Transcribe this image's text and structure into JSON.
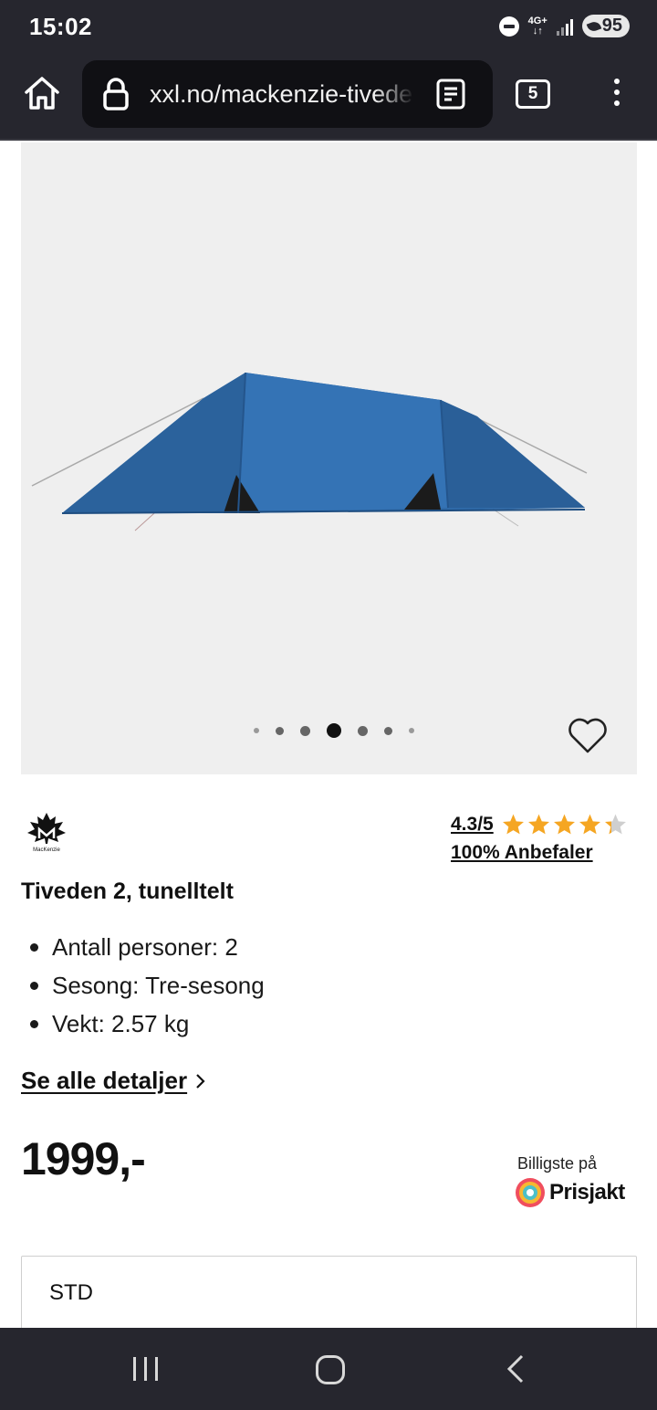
{
  "status_bar": {
    "time": "15:02",
    "network": "4G+",
    "battery": "95",
    "icons": [
      "dnd-icon",
      "signal-icon",
      "battery-icon"
    ]
  },
  "browser": {
    "url": "xxl.no/mackenzie-tiveden",
    "tab_count": "5",
    "icons": [
      "home-icon",
      "lock-icon",
      "reader-mode-icon",
      "tabs-icon",
      "menu-icon"
    ]
  },
  "gallery": {
    "image_count": 7,
    "active_index": 3,
    "icons": [
      "heart-icon"
    ]
  },
  "product": {
    "brand": "MacKenzie",
    "rating_text": "4.3/5",
    "rating_value": 4.3,
    "rating_max": 5,
    "recommend_text": "100% Anbefaler",
    "title": "Tiveden 2, tunelltelt",
    "specs": [
      "Antall personer: 2",
      "Sesong: Tre-sesong",
      "Vekt: 2.57 kg"
    ],
    "details_link": "Se alle detaljer",
    "price": "1999,-",
    "prisjakt_label": "Billigste på",
    "prisjakt_name": "Prisjakt",
    "variant": "STD"
  },
  "colors": {
    "chrome": "#26262e",
    "star": "#f5a623",
    "tent": "#2f6aa8"
  },
  "nav_bar": {
    "icons": [
      "recent-apps-icon",
      "home-button-icon",
      "back-icon"
    ]
  }
}
